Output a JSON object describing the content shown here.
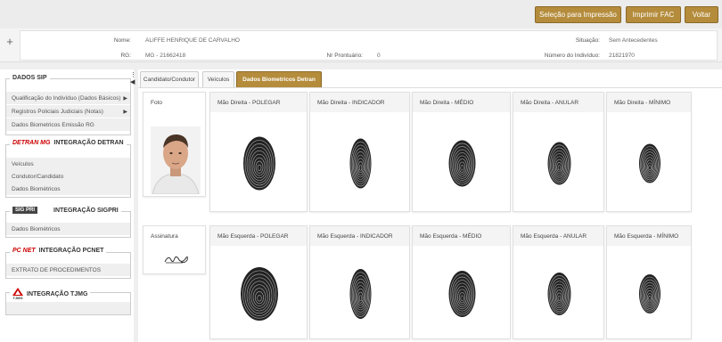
{
  "toolbar": {
    "print_selection_label": "Seleção para Impressão",
    "print_fac_label": "Imprimir FAC",
    "back_label": "Voltar",
    "button_color": "#b48c3c"
  },
  "info": {
    "expand_icon": "plus-icon",
    "name_label": "Nome:",
    "name_value": "ALIFFE HENRIQUE DE CARVALHO",
    "rg_label": "RG:",
    "rg_value": "MG - 21662418",
    "prontuario_label": "Nr Prontuário:",
    "prontuario_value": "0",
    "situacao_label": "Situação:",
    "situacao_value": "Sem Antecedentes",
    "individuo_label": "Número do Indivíduo:",
    "individuo_value": "21821970"
  },
  "sidebar": {
    "dados_sip": {
      "title": "DADOS SIP",
      "items": [
        {
          "label": "Qualificação do Indivíduo (Dados Básicos)",
          "arrow": "▶"
        },
        {
          "label": "Registros Policiais Judiciais (Notas)",
          "arrow": "▶"
        },
        {
          "label": "Dados Biometricos Emissão RG",
          "arrow": ""
        }
      ]
    },
    "detran": {
      "logo_text": "DETRAN MG",
      "title": "INTEGRAÇÃO DETRAN",
      "items": [
        {
          "label": "Veículos"
        },
        {
          "label": "Condutor/Candidato"
        },
        {
          "label": "Dados Biométricos"
        }
      ]
    },
    "sigpri": {
      "logo_text": "SIG PRI",
      "title": "INTEGRAÇÃO SIGPRI",
      "items": [
        {
          "label": "Dados Biométricos"
        }
      ]
    },
    "pcnet": {
      "logo_text": "PC NET",
      "title": "INTEGRAÇÃO PCNET",
      "items": [
        {
          "label": "EXTRATO DE PROCEDIMENTOS"
        }
      ]
    },
    "tjmg": {
      "logo_text": "TJMG",
      "title": "INTEGRAÇÃO TJMG"
    }
  },
  "tabs": [
    {
      "label": "Candidato/Condutor",
      "active": false
    },
    {
      "label": "Veículos",
      "active": false
    },
    {
      "label": "Dados Biometricos Detran",
      "active": true
    }
  ],
  "biometrics": {
    "foto_label": "Foto",
    "assinatura_label": "Assinatura",
    "right_hand": [
      {
        "label": "Mão Direita - POLEGAR"
      },
      {
        "label": "Mão Direita - INDICADOR"
      },
      {
        "label": "Mão Direita - MÉDIO"
      },
      {
        "label": "Mão Direita - ANULAR"
      },
      {
        "label": "Mão Direita - MÍNIMO"
      }
    ],
    "left_hand": [
      {
        "label": "Mão Esquerda - POLEGAR"
      },
      {
        "label": "Mão Esquerda - INDICADOR"
      },
      {
        "label": "Mão Esquerda - MÉDIO"
      },
      {
        "label": "Mão Esquerda - ANULAR"
      },
      {
        "label": "Mão Esquerda - MÍNIMO"
      }
    ]
  }
}
